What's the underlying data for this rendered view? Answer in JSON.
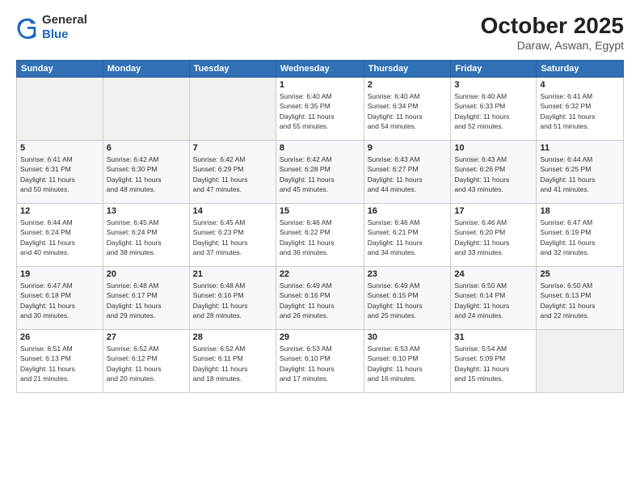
{
  "logo": {
    "general": "General",
    "blue": "Blue"
  },
  "header": {
    "month": "October 2025",
    "location": "Daraw, Aswan, Egypt"
  },
  "weekdays": [
    "Sunday",
    "Monday",
    "Tuesday",
    "Wednesday",
    "Thursday",
    "Friday",
    "Saturday"
  ],
  "weeks": [
    [
      {
        "day": "",
        "info": ""
      },
      {
        "day": "",
        "info": ""
      },
      {
        "day": "",
        "info": ""
      },
      {
        "day": "1",
        "info": "Sunrise: 6:40 AM\nSunset: 6:35 PM\nDaylight: 11 hours\nand 55 minutes."
      },
      {
        "day": "2",
        "info": "Sunrise: 6:40 AM\nSunset: 6:34 PM\nDaylight: 11 hours\nand 54 minutes."
      },
      {
        "day": "3",
        "info": "Sunrise: 6:40 AM\nSunset: 6:33 PM\nDaylight: 11 hours\nand 52 minutes."
      },
      {
        "day": "4",
        "info": "Sunrise: 6:41 AM\nSunset: 6:32 PM\nDaylight: 11 hours\nand 51 minutes."
      }
    ],
    [
      {
        "day": "5",
        "info": "Sunrise: 6:41 AM\nSunset: 6:31 PM\nDaylight: 11 hours\nand 50 minutes."
      },
      {
        "day": "6",
        "info": "Sunrise: 6:42 AM\nSunset: 6:30 PM\nDaylight: 11 hours\nand 48 minutes."
      },
      {
        "day": "7",
        "info": "Sunrise: 6:42 AM\nSunset: 6:29 PM\nDaylight: 11 hours\nand 47 minutes."
      },
      {
        "day": "8",
        "info": "Sunrise: 6:42 AM\nSunset: 6:28 PM\nDaylight: 11 hours\nand 45 minutes."
      },
      {
        "day": "9",
        "info": "Sunrise: 6:43 AM\nSunset: 6:27 PM\nDaylight: 11 hours\nand 44 minutes."
      },
      {
        "day": "10",
        "info": "Sunrise: 6:43 AM\nSunset: 6:26 PM\nDaylight: 11 hours\nand 43 minutes."
      },
      {
        "day": "11",
        "info": "Sunrise: 6:44 AM\nSunset: 6:25 PM\nDaylight: 11 hours\nand 41 minutes."
      }
    ],
    [
      {
        "day": "12",
        "info": "Sunrise: 6:44 AM\nSunset: 6:24 PM\nDaylight: 11 hours\nand 40 minutes."
      },
      {
        "day": "13",
        "info": "Sunrise: 6:45 AM\nSunset: 6:24 PM\nDaylight: 11 hours\nand 38 minutes."
      },
      {
        "day": "14",
        "info": "Sunrise: 6:45 AM\nSunset: 6:23 PM\nDaylight: 11 hours\nand 37 minutes."
      },
      {
        "day": "15",
        "info": "Sunrise: 6:46 AM\nSunset: 6:22 PM\nDaylight: 11 hours\nand 36 minutes."
      },
      {
        "day": "16",
        "info": "Sunrise: 6:46 AM\nSunset: 6:21 PM\nDaylight: 11 hours\nand 34 minutes."
      },
      {
        "day": "17",
        "info": "Sunrise: 6:46 AM\nSunset: 6:20 PM\nDaylight: 11 hours\nand 33 minutes."
      },
      {
        "day": "18",
        "info": "Sunrise: 6:47 AM\nSunset: 6:19 PM\nDaylight: 11 hours\nand 32 minutes."
      }
    ],
    [
      {
        "day": "19",
        "info": "Sunrise: 6:47 AM\nSunset: 6:18 PM\nDaylight: 11 hours\nand 30 minutes."
      },
      {
        "day": "20",
        "info": "Sunrise: 6:48 AM\nSunset: 6:17 PM\nDaylight: 11 hours\nand 29 minutes."
      },
      {
        "day": "21",
        "info": "Sunrise: 6:48 AM\nSunset: 6:16 PM\nDaylight: 11 hours\nand 28 minutes."
      },
      {
        "day": "22",
        "info": "Sunrise: 6:49 AM\nSunset: 6:16 PM\nDaylight: 11 hours\nand 26 minutes."
      },
      {
        "day": "23",
        "info": "Sunrise: 6:49 AM\nSunset: 6:15 PM\nDaylight: 11 hours\nand 25 minutes."
      },
      {
        "day": "24",
        "info": "Sunrise: 6:50 AM\nSunset: 6:14 PM\nDaylight: 11 hours\nand 24 minutes."
      },
      {
        "day": "25",
        "info": "Sunrise: 6:50 AM\nSunset: 6:13 PM\nDaylight: 11 hours\nand 22 minutes."
      }
    ],
    [
      {
        "day": "26",
        "info": "Sunrise: 6:51 AM\nSunset: 6:13 PM\nDaylight: 11 hours\nand 21 minutes."
      },
      {
        "day": "27",
        "info": "Sunrise: 6:52 AM\nSunset: 6:12 PM\nDaylight: 11 hours\nand 20 minutes."
      },
      {
        "day": "28",
        "info": "Sunrise: 6:52 AM\nSunset: 6:11 PM\nDaylight: 11 hours\nand 18 minutes."
      },
      {
        "day": "29",
        "info": "Sunrise: 6:53 AM\nSunset: 6:10 PM\nDaylight: 11 hours\nand 17 minutes."
      },
      {
        "day": "30",
        "info": "Sunrise: 6:53 AM\nSunset: 6:10 PM\nDaylight: 11 hours\nand 16 minutes."
      },
      {
        "day": "31",
        "info": "Sunrise: 5:54 AM\nSunset: 5:09 PM\nDaylight: 11 hours\nand 15 minutes."
      },
      {
        "day": "",
        "info": ""
      }
    ]
  ]
}
